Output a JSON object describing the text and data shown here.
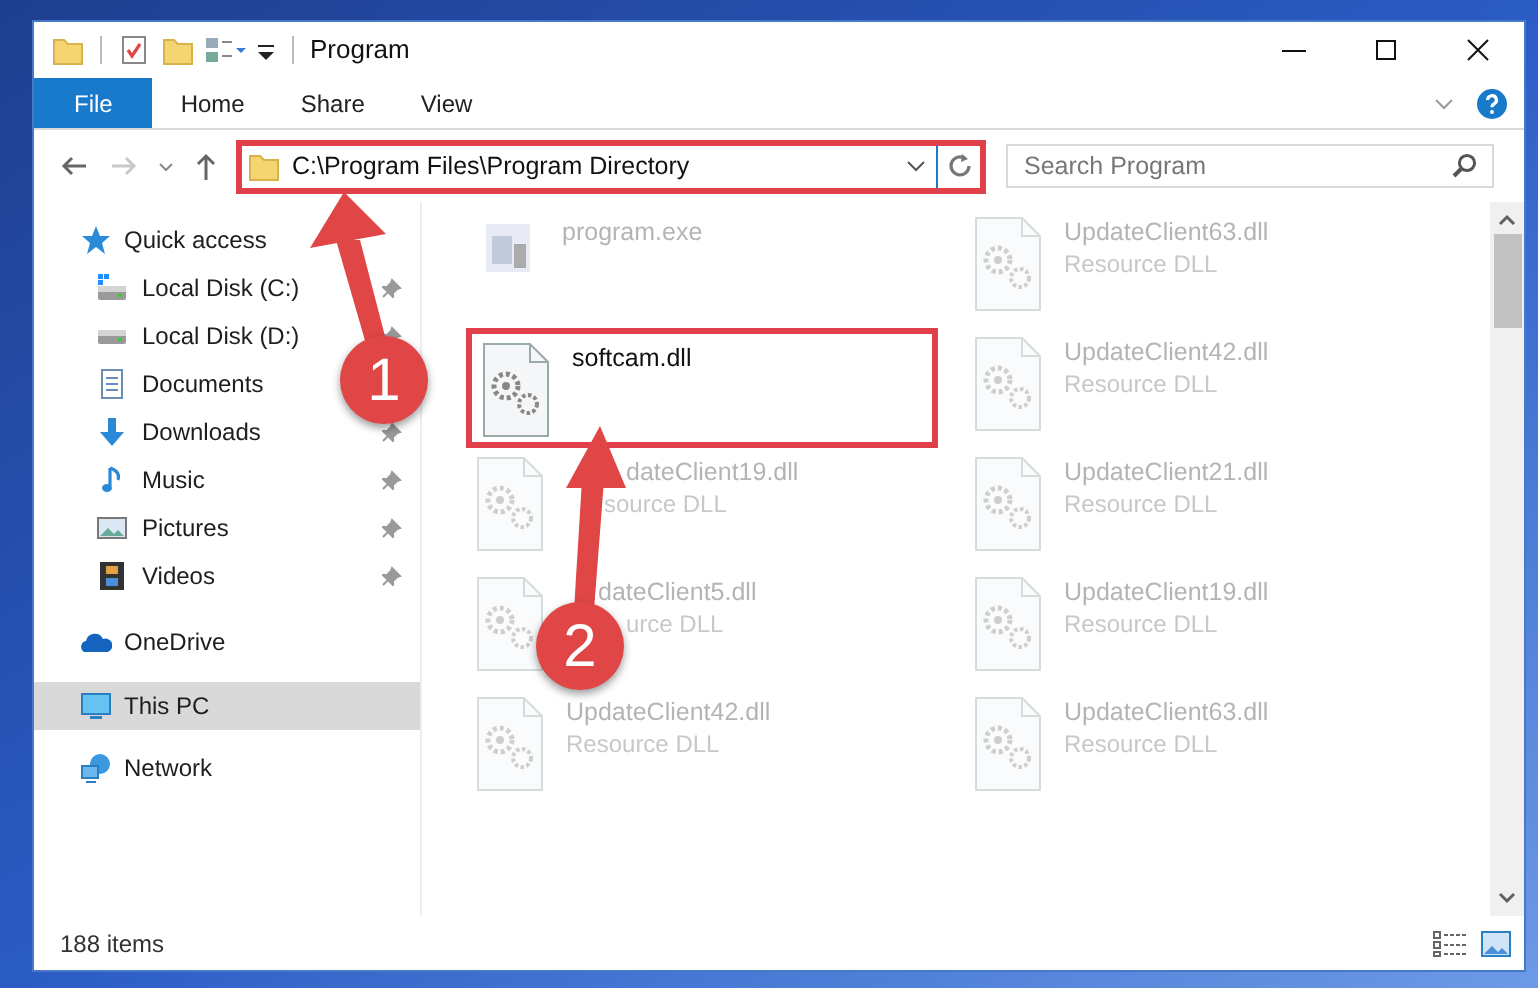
{
  "window": {
    "title": "Program"
  },
  "ribbon_tabs": [
    {
      "label": "File",
      "selected": true
    },
    {
      "label": "Home",
      "selected": false
    },
    {
      "label": "Share",
      "selected": false
    },
    {
      "label": "View",
      "selected": false
    }
  ],
  "address": {
    "path": "C:\\Program Files\\Program Directory",
    "highlighted": true
  },
  "search": {
    "placeholder": "Search Program"
  },
  "sidebar": {
    "items": [
      {
        "label": "Quick access",
        "selected": false,
        "children": [
          {
            "label": "Local Disk (C:)",
            "pinned": true
          },
          {
            "label": "Local Disk (D:)",
            "pinned": true
          },
          {
            "label": "Documents"
          },
          {
            "label": "Downloads",
            "pinned": true
          },
          {
            "label": "Music",
            "pinned": true
          },
          {
            "label": "Pictures",
            "pinned": true
          },
          {
            "label": "Videos",
            "pinned": true
          }
        ]
      },
      {
        "label": "OneDrive",
        "selected": false
      },
      {
        "label": "This PC",
        "selected": true
      },
      {
        "label": "Network",
        "selected": false
      }
    ]
  },
  "files": [
    {
      "kind": "exe",
      "name": "program.exe",
      "dimmed": true,
      "highlighted": false
    },
    {
      "kind": "dll",
      "name": "UpdateClient63.dll",
      "type": "Resource DLL",
      "dimmed": true,
      "highlighted": false
    },
    {
      "kind": "dll",
      "name": "softcam.dll",
      "dimmed": false,
      "highlighted": true
    },
    {
      "kind": "dll",
      "name": "UpdateClient42.dll",
      "type": "Resource DLL",
      "dimmed": true,
      "highlighted": false
    },
    {
      "kind": "dll",
      "name": "dateClient19.dll",
      "type": "source DLL",
      "dimmed": true,
      "highlighted": false
    },
    {
      "kind": "dll",
      "name": "UpdateClient21.dll",
      "type": "Resource DLL",
      "dimmed": true,
      "highlighted": false
    },
    {
      "kind": "dll",
      "name": "dateClient5.dll",
      "type": "urce DLL",
      "dimmed": true,
      "highlighted": false
    },
    {
      "kind": "dll",
      "name": "UpdateClient19.dll",
      "type": "Resource DLL",
      "dimmed": true,
      "highlighted": false
    },
    {
      "kind": "dll",
      "name": "UpdateClient42.dll",
      "type": "Resource DLL",
      "dimmed": true,
      "highlighted": false
    },
    {
      "kind": "dll",
      "name": "UpdateClient63.dll",
      "type": "Resource DLL",
      "dimmed": true,
      "highlighted": false
    }
  ],
  "status_bar": {
    "item_count": "188 items"
  },
  "annotations": [
    {
      "label": "1"
    },
    {
      "label": "2"
    }
  ]
}
